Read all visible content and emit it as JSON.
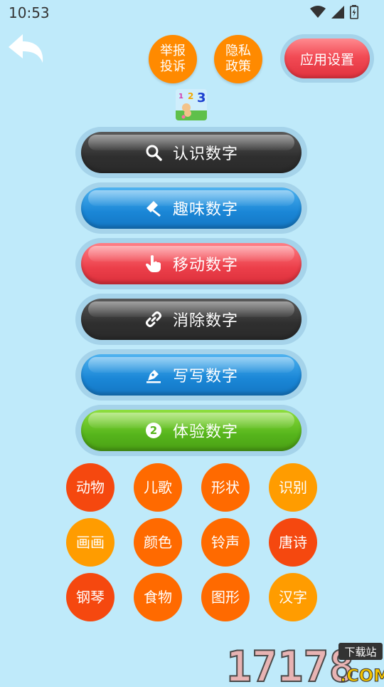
{
  "status": {
    "time": "10:53"
  },
  "header": {
    "report_label": "举报\n投诉",
    "privacy_label": "隐私\n政策",
    "settings_label": "应用设置"
  },
  "logo": {
    "digits": [
      "1",
      "2",
      "3"
    ]
  },
  "menu": [
    {
      "label": "认识数字",
      "icon": "search-icon"
    },
    {
      "label": "趣味数字",
      "icon": "hammer-icon"
    },
    {
      "label": "移动数字",
      "icon": "hand-pointer-icon"
    },
    {
      "label": "消除数字",
      "icon": "link-icon"
    },
    {
      "label": "写写数字",
      "icon": "pen-icon"
    },
    {
      "label": "体验数字",
      "icon": "number-two-icon",
      "icon_text": "2"
    }
  ],
  "categories": [
    {
      "label": "动物"
    },
    {
      "label": "儿歌"
    },
    {
      "label": "形状"
    },
    {
      "label": "识别"
    },
    {
      "label": "画画"
    },
    {
      "label": "颜色"
    },
    {
      "label": "铃声"
    },
    {
      "label": "唐诗"
    },
    {
      "label": "钢琴"
    },
    {
      "label": "食物"
    },
    {
      "label": "图形"
    },
    {
      "label": "汉字"
    }
  ],
  "watermark": {
    "number": "17178",
    "tag": "下载站",
    "domain": ".COM"
  },
  "colors": {
    "background": "#bfeafa",
    "orange": "#ff8a00",
    "red_orange": "#f5480f",
    "amber": "#ff9c00",
    "dark": "#2f2f2f",
    "blue": "#1a86d6",
    "red": "#ec3f4a",
    "green": "#56b51c"
  }
}
